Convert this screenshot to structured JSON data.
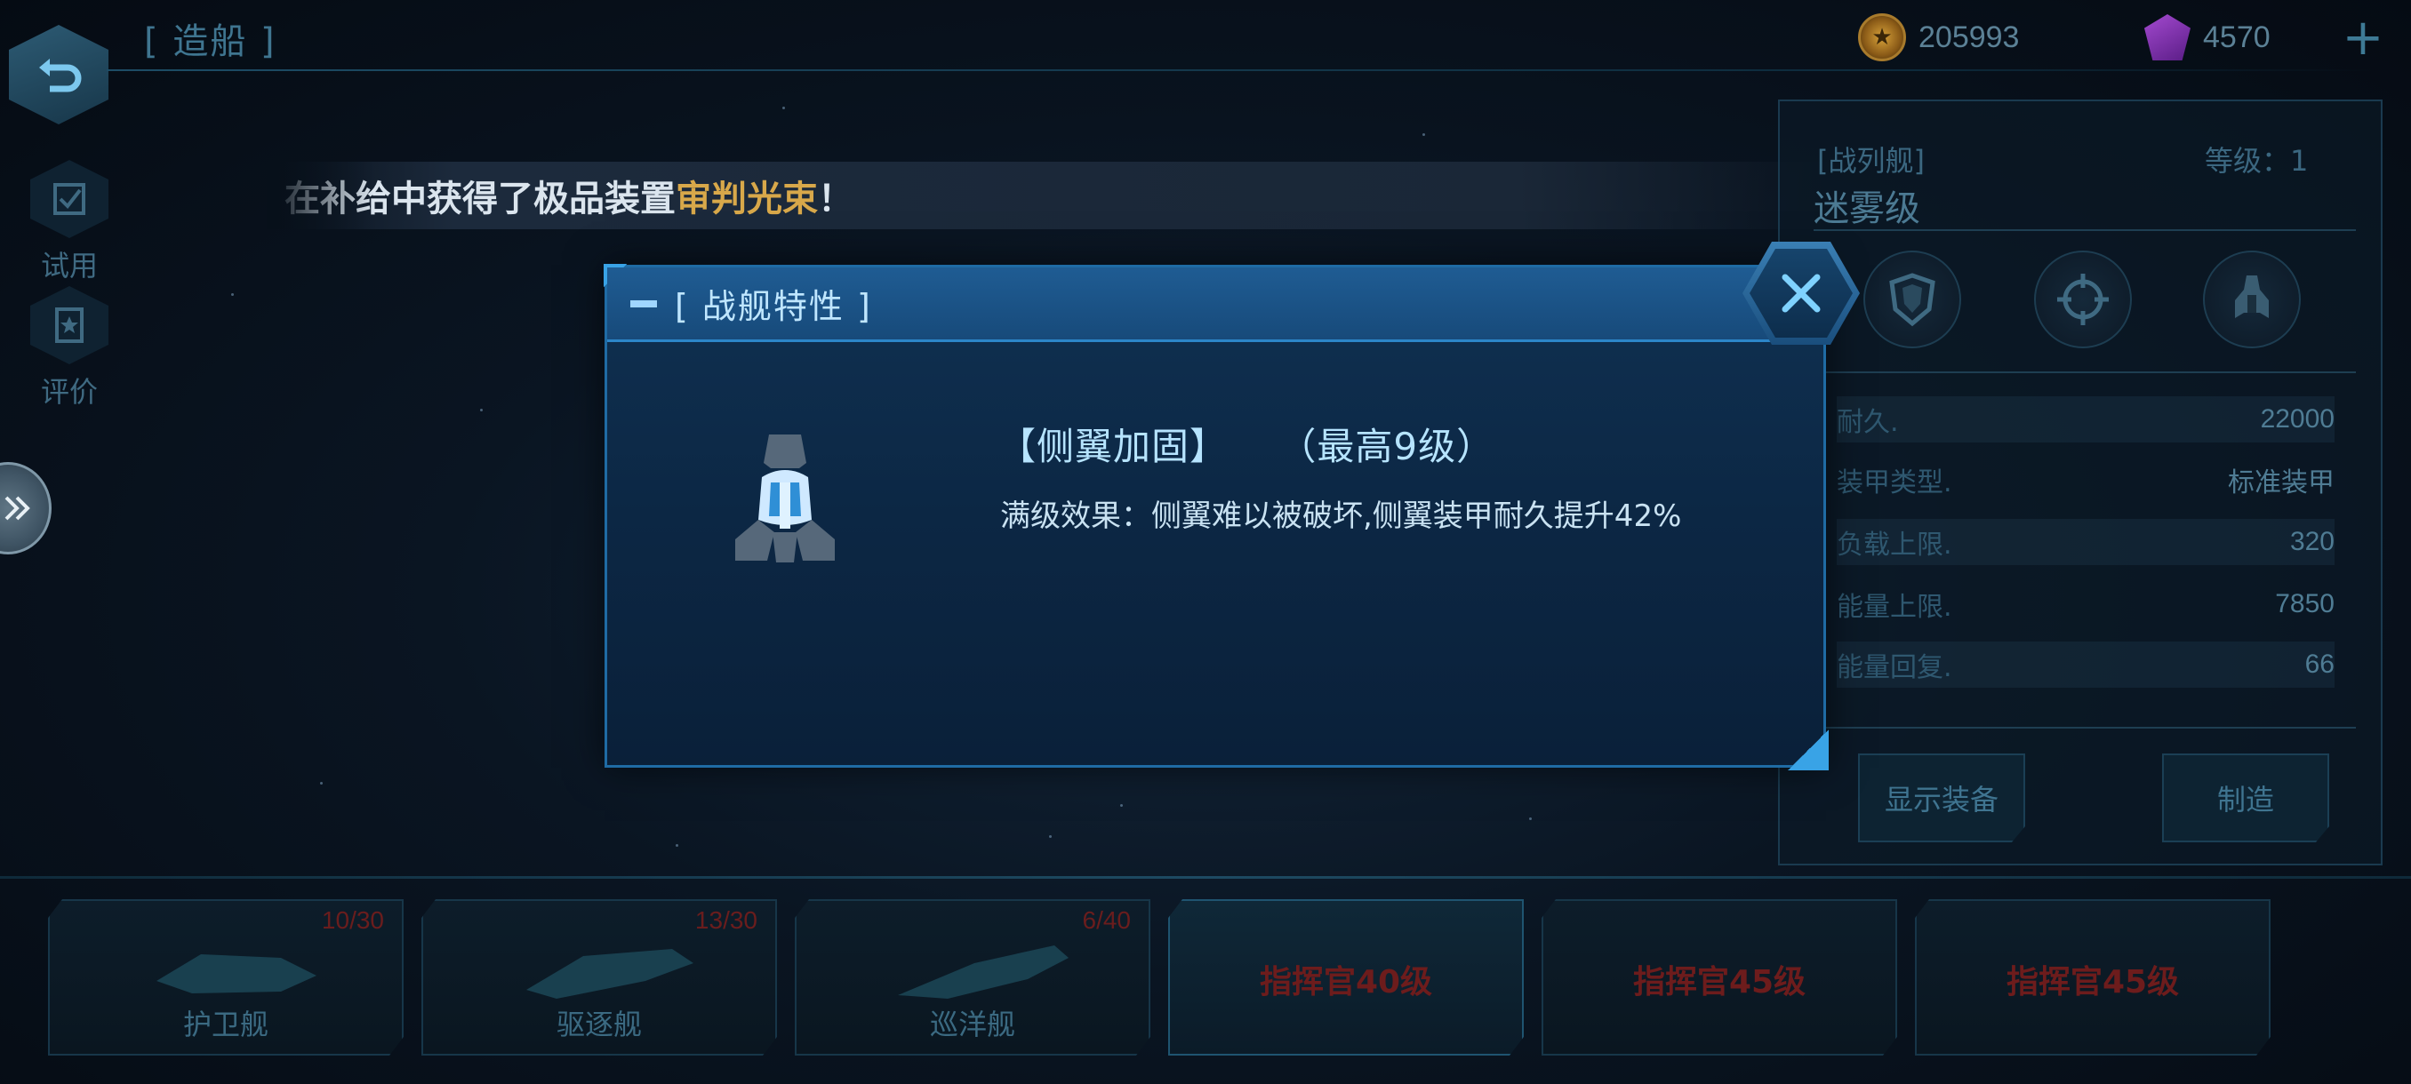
{
  "header": {
    "title": "[ 造船 ]",
    "coins": "205993",
    "gems": "4570",
    "add_label": "+"
  },
  "side": {
    "trial_label": "试用",
    "review_label": "评价"
  },
  "notice": {
    "prefix": "在补给中获得了极品装置",
    "item": "审判光束",
    "suffix": "！"
  },
  "ship_panel": {
    "class": "[战列舰]",
    "level_label": "等级：1",
    "name": "迷雾级",
    "icons": [
      "armor-shield-icon",
      "target-crosshair-icon",
      "ship-wing-icon"
    ],
    "stats": [
      {
        "label": "耐久.",
        "value": "22000"
      },
      {
        "label": "装甲类型.",
        "value": "标准装甲"
      },
      {
        "label": "负载上限.",
        "value": "320"
      },
      {
        "label": "能量上限.",
        "value": "7850"
      },
      {
        "label": "能量回复.",
        "value": "66"
      }
    ],
    "show_equipment_label": "显示装备",
    "build_label": "制造"
  },
  "ship_cards": [
    {
      "name": "护卫舰",
      "count": "10/30",
      "lock": ""
    },
    {
      "name": "驱逐舰",
      "count": "13/30",
      "lock": ""
    },
    {
      "name": "巡洋舰",
      "count": "6/40",
      "lock": ""
    },
    {
      "name": "",
      "count": "",
      "lock": "指挥官40级"
    },
    {
      "name": "",
      "count": "",
      "lock": "指挥官45级"
    },
    {
      "name": "",
      "count": "",
      "lock": "指挥官45级"
    }
  ],
  "modal": {
    "title": "[ 战舰特性 ]",
    "trait_name": "【侧翼加固】",
    "trait_max": "（最高9级）",
    "trait_effect": "满级效果：侧翼难以被破坏,侧翼装甲耐久提升42%",
    "close_icon": "close-x-icon"
  },
  "colors": {
    "accent": "#2c86c9",
    "highlight_gold": "#d8a84a",
    "locked_red": "#6d1c1c"
  }
}
